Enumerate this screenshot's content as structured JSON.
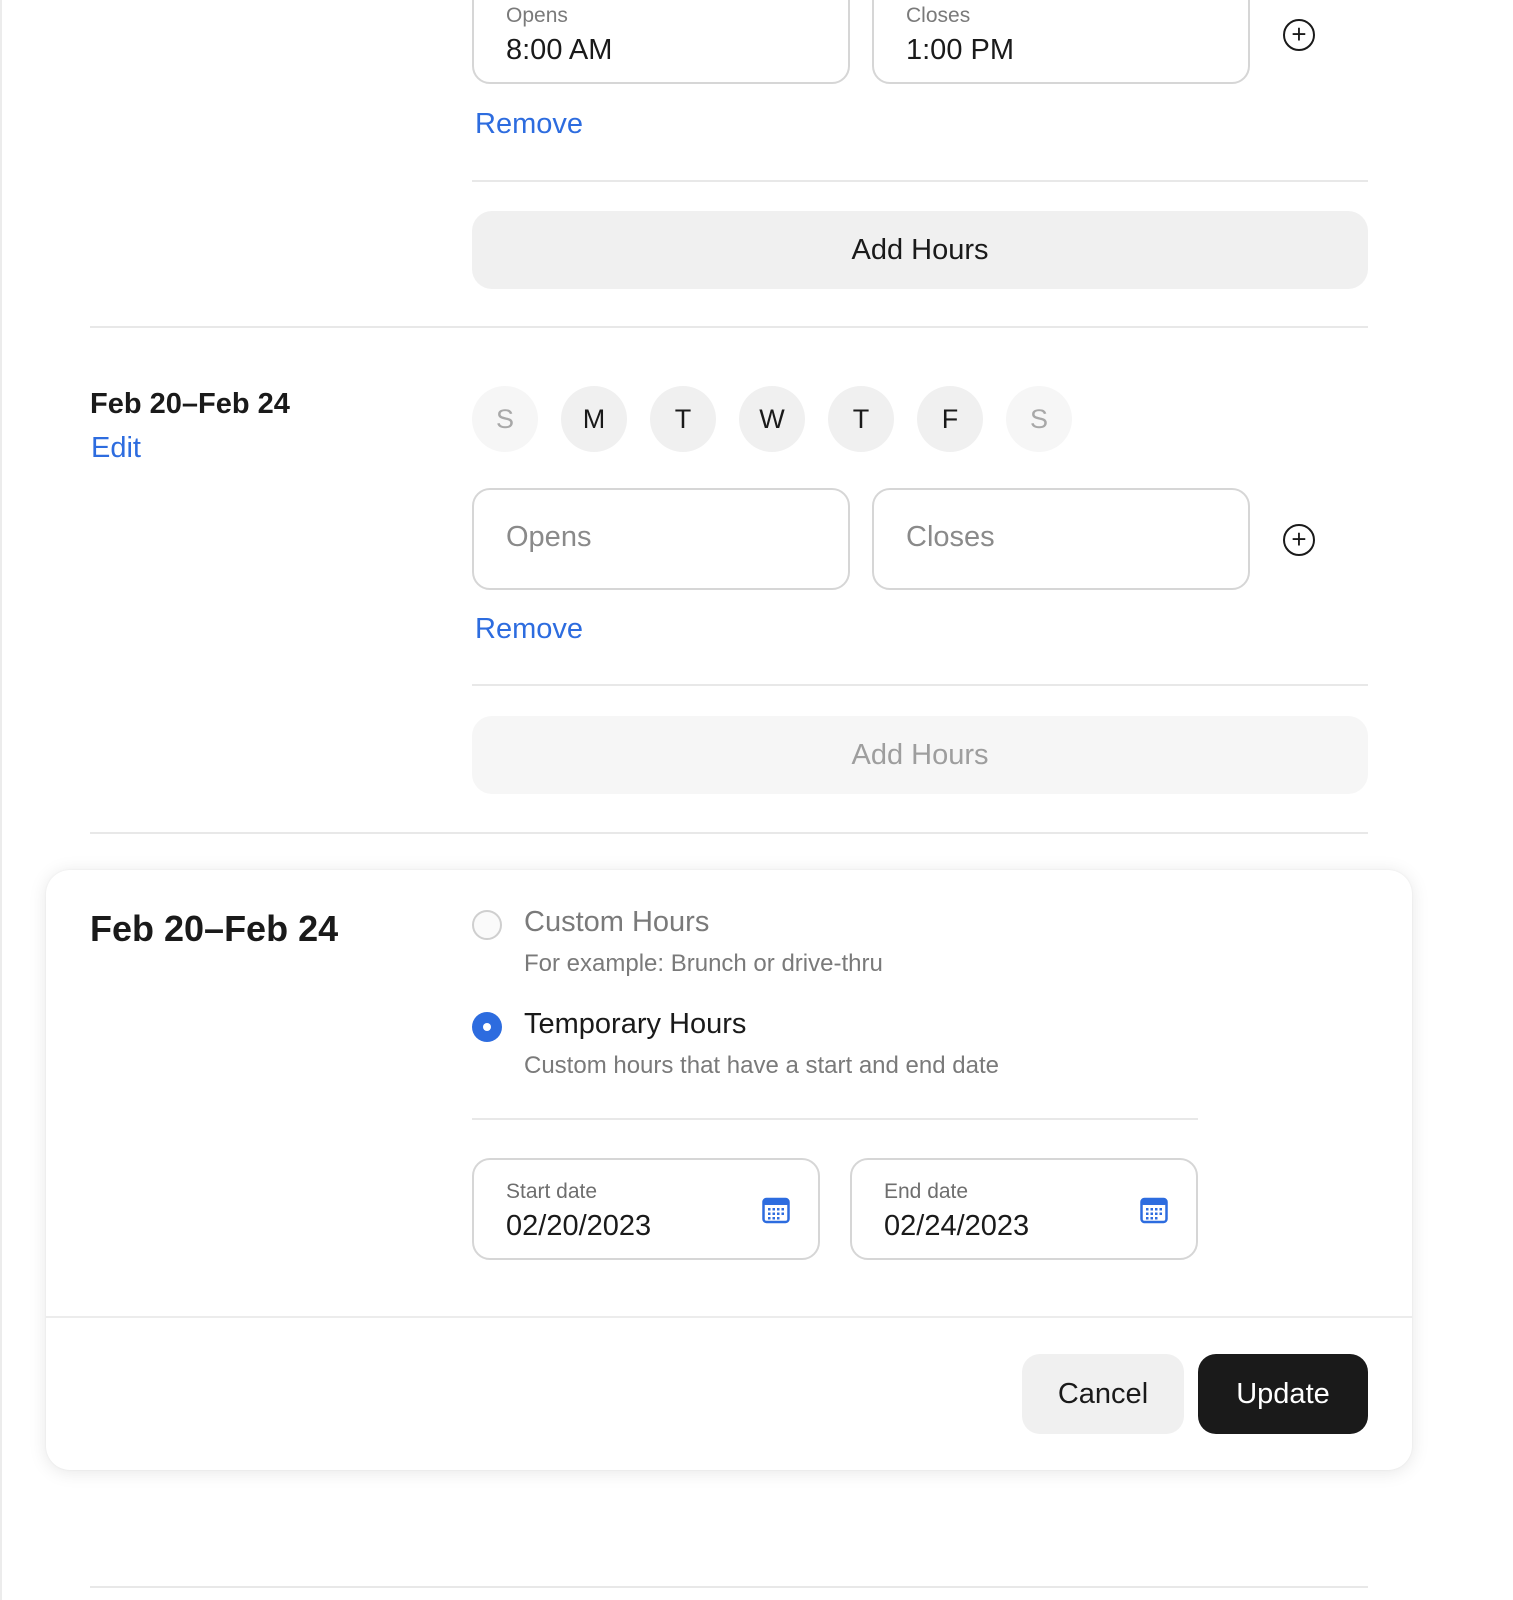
{
  "top_block": {
    "opens": {
      "label": "Opens",
      "value": "8:00 AM"
    },
    "closes": {
      "label": "Closes",
      "value": "1:00 PM"
    },
    "remove_label": "Remove",
    "add_hours_label": "Add Hours"
  },
  "second_block": {
    "title": "Feb 20–Feb 24",
    "edit_label": "Edit",
    "days": [
      {
        "letter": "S",
        "selected": false
      },
      {
        "letter": "M",
        "selected": true
      },
      {
        "letter": "T",
        "selected": true
      },
      {
        "letter": "W",
        "selected": true
      },
      {
        "letter": "T",
        "selected": true
      },
      {
        "letter": "F",
        "selected": true
      },
      {
        "letter": "S",
        "selected": false
      }
    ],
    "opens_placeholder": "Opens",
    "closes_placeholder": "Closes",
    "remove_label": "Remove",
    "add_hours_label": "Add Hours"
  },
  "modal": {
    "title": "Feb 20–Feb 24",
    "options": [
      {
        "title": "Custom Hours",
        "subtitle": "For example: Brunch or drive-thru",
        "checked": false
      },
      {
        "title": "Temporary Hours",
        "subtitle": "Custom hours that have a start and end date",
        "checked": true
      }
    ],
    "start_date": {
      "label": "Start date",
      "value": "02/20/2023"
    },
    "end_date": {
      "label": "End date",
      "value": "02/24/2023"
    },
    "cancel_label": "Cancel",
    "update_label": "Update"
  },
  "colors": {
    "accent": "#2d6cdf",
    "primary_button": "#1a1a1a"
  }
}
